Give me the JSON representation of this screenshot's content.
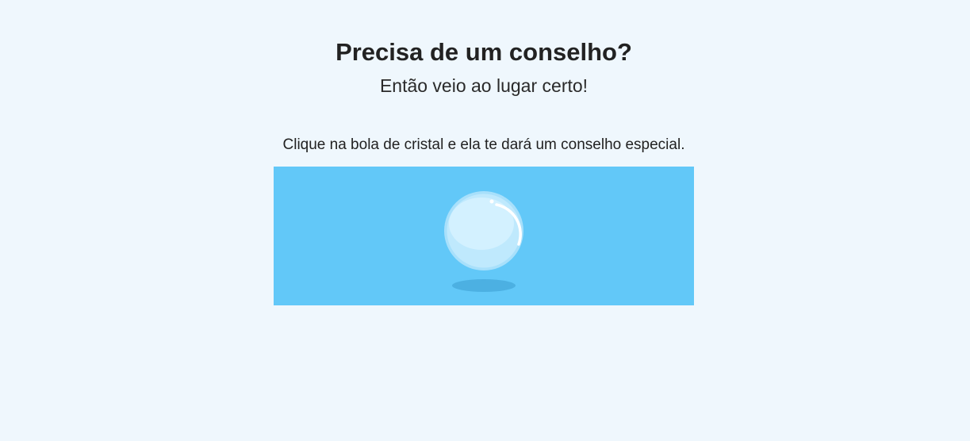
{
  "header": {
    "title": "Precisa de um conselho?",
    "subtitle": "Então veio ao lugar certo!"
  },
  "main": {
    "instruction": "Clique na bola de cristal e ela te dará um conselho especial.",
    "crystal_ball": {
      "icon": "crystal-ball-icon",
      "panel_color": "#62c8f8",
      "ball_color": "#cdefff",
      "shadow_color": "#4cb0e2"
    }
  }
}
